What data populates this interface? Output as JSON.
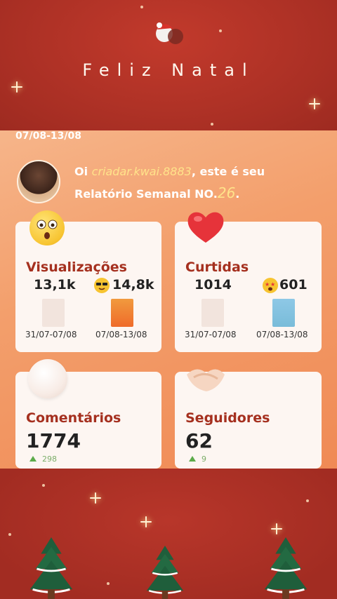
{
  "header": {
    "title": "Feliz Natal"
  },
  "report": {
    "date_range": "07/08-13/08",
    "greeting_prefix": "Oi ",
    "username": "criadar.kwai.8883",
    "greeting_mid": ", este é seu",
    "greeting_line2": "Relatório Semanal NO.",
    "report_number": "26",
    "greeting_end": "."
  },
  "cards": {
    "views": {
      "label": "Visualizações",
      "previous": "13,1k",
      "current": "14,8k",
      "prev_period": "31/07-07/08",
      "curr_period": "07/08-13/08"
    },
    "likes": {
      "label": "Curtidas",
      "previous": "1014",
      "current": "601",
      "prev_period": "31/07-07/08",
      "curr_period": "07/08-13/08"
    },
    "comments": {
      "label": "Comentários",
      "value": "1774",
      "delta": "298"
    },
    "followers": {
      "label": "Seguidores",
      "value": "62",
      "delta": "9"
    }
  },
  "icons": [
    "santa-hat-icon",
    "surprised-face-icon",
    "heart-icon",
    "cool-face-icon",
    "star-eyes-icon",
    "cotton-ball-icon",
    "handshake-icon",
    "christmas-tree-icon"
  ],
  "colors": {
    "background_red": "#b23427",
    "panel_orange": "#f39f6c",
    "label_red": "#a5301f",
    "bar_orange": "#f07a2a",
    "bar_blue": "#86c3e0",
    "delta_green": "#5cab4a"
  }
}
